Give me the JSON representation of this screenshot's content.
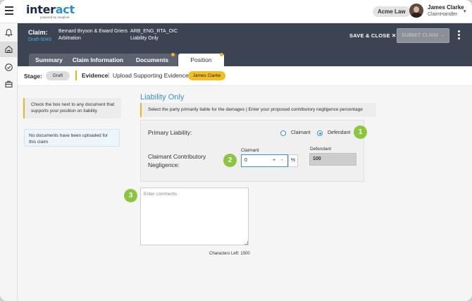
{
  "app": {
    "logo_text": "inter",
    "logo_accent": "act",
    "logo_tagline": "powered by nexplore"
  },
  "header": {
    "org": "Acme Law",
    "user_name": "James Clarke",
    "user_role": "ClaimHandler"
  },
  "sidebar": {
    "icons": [
      "bell-icon",
      "home-icon",
      "check-circle-icon",
      "briefcase-icon"
    ],
    "active": "home-icon"
  },
  "claim": {
    "label": "Claim:",
    "id": "Draft-0049",
    "parties": "Bernard Bryson & Eward Griers",
    "type": "Arbitration",
    "code": "ARB_ENG_RTA_OIC",
    "liability": "Liability Only",
    "save_close": "SAVE & CLOSE ✕",
    "submit": "SUBMIT CLAIM →"
  },
  "tabs": [
    {
      "label": "Summary",
      "active": false,
      "dot": false
    },
    {
      "label": "Claim Information",
      "active": false,
      "dot": false
    },
    {
      "label": "Documents",
      "active": false,
      "dot": true
    },
    {
      "label": "Position",
      "active": true,
      "dot": true
    }
  ],
  "stage": {
    "label": "Stage:",
    "status": "Draft",
    "step": "Evidence",
    "separator": "|",
    "sub_step": "Upload Supporting Evidence",
    "assignee": "James Clarke"
  },
  "documents": {
    "instruction": "Check the box next to any document that supports your position on liability",
    "empty": "No documents have been uploaded for this claim"
  },
  "position": {
    "title": "Liability Only",
    "instruction": "Select the party primarily liable for the damages | Enter your proposed contributory negligence percentage",
    "primary_label": "Primary Liability:",
    "options": [
      {
        "label": "Claimant",
        "checked": false
      },
      {
        "label": "Defendant",
        "checked": true
      }
    ],
    "cn_label": "Claimant Contributory Negligence:",
    "claimant_caption": "Claimant",
    "claimant_value": "0",
    "stepper_plus": "+",
    "stepper_minus": "-",
    "percent": "%",
    "defendant_caption": "Defendant",
    "defendant_value": "100",
    "comments_placeholder": "Enter comments",
    "chars_left": "Characters Left: 1500"
  },
  "callouts": [
    "1",
    "2",
    "3"
  ],
  "colors": {
    "navy": "#3c4453",
    "accent_blue": "#3b8fd0",
    "amber": "#f2b320",
    "callout_green": "#8cc63f"
  }
}
